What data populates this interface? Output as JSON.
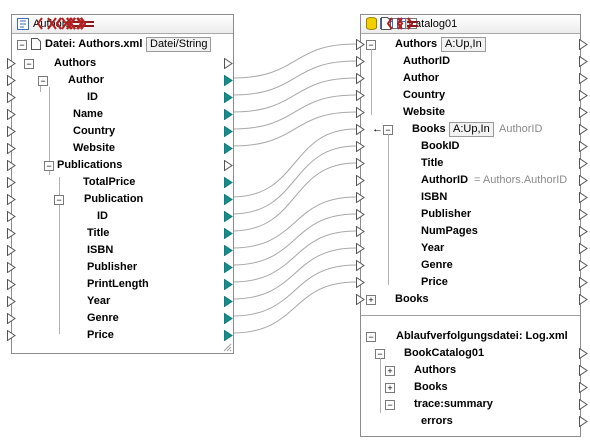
{
  "source": {
    "title": "Authors",
    "file_label": "Datei: Authors.xml",
    "file_button": "Datei/String",
    "items": [
      {
        "label": "Authors"
      },
      {
        "label": "Author"
      },
      {
        "label": "ID"
      },
      {
        "label": "Name"
      },
      {
        "label": "Country"
      },
      {
        "label": "Website"
      },
      {
        "label": "Publications"
      },
      {
        "label": "TotalPrice"
      },
      {
        "label": "Publication"
      },
      {
        "label": "ID"
      },
      {
        "label": "Title"
      },
      {
        "label": "ISBN"
      },
      {
        "label": "Publisher"
      },
      {
        "label": "PrintLength"
      },
      {
        "label": "Year"
      },
      {
        "label": "Genre"
      },
      {
        "label": "Price"
      }
    ]
  },
  "target": {
    "title": "BookCatalog01",
    "authors_label": "Authors",
    "authors_action": "A:Up,In",
    "authors_items": [
      {
        "label": "AuthorID"
      },
      {
        "label": "Author"
      },
      {
        "label": "Country"
      },
      {
        "label": "Website"
      }
    ],
    "books_label": "Books",
    "books_action": "A:Up,In",
    "books_hint": "AuthorID",
    "books_items": [
      {
        "label": "BookID"
      },
      {
        "label": "Title"
      },
      {
        "label": "AuthorID"
      },
      {
        "label": "ISBN"
      },
      {
        "label": "Publisher"
      },
      {
        "label": "NumPages"
      },
      {
        "label": "Year"
      },
      {
        "label": "Genre"
      },
      {
        "label": "Price"
      }
    ],
    "authorid_join": "= Authors.AuthorID",
    "books_collapsed_label": "Books"
  },
  "log": {
    "file_label": "Ablaufverfolgungsdatei: Log.xml",
    "root": "BookCatalog01",
    "items": [
      {
        "label": "Authors"
      },
      {
        "label": "Books"
      },
      {
        "label": "trace:summary"
      },
      {
        "label": "errors"
      }
    ]
  },
  "colors": {
    "connector": "#0d7f7f",
    "connector_fill": "#1a8a8a",
    "element_icon": "#b22222",
    "attr_icon": "#8b1a1a",
    "key_icon": "#d8a000",
    "db_icon": "#e8c200",
    "line": "#9a9a9a"
  }
}
